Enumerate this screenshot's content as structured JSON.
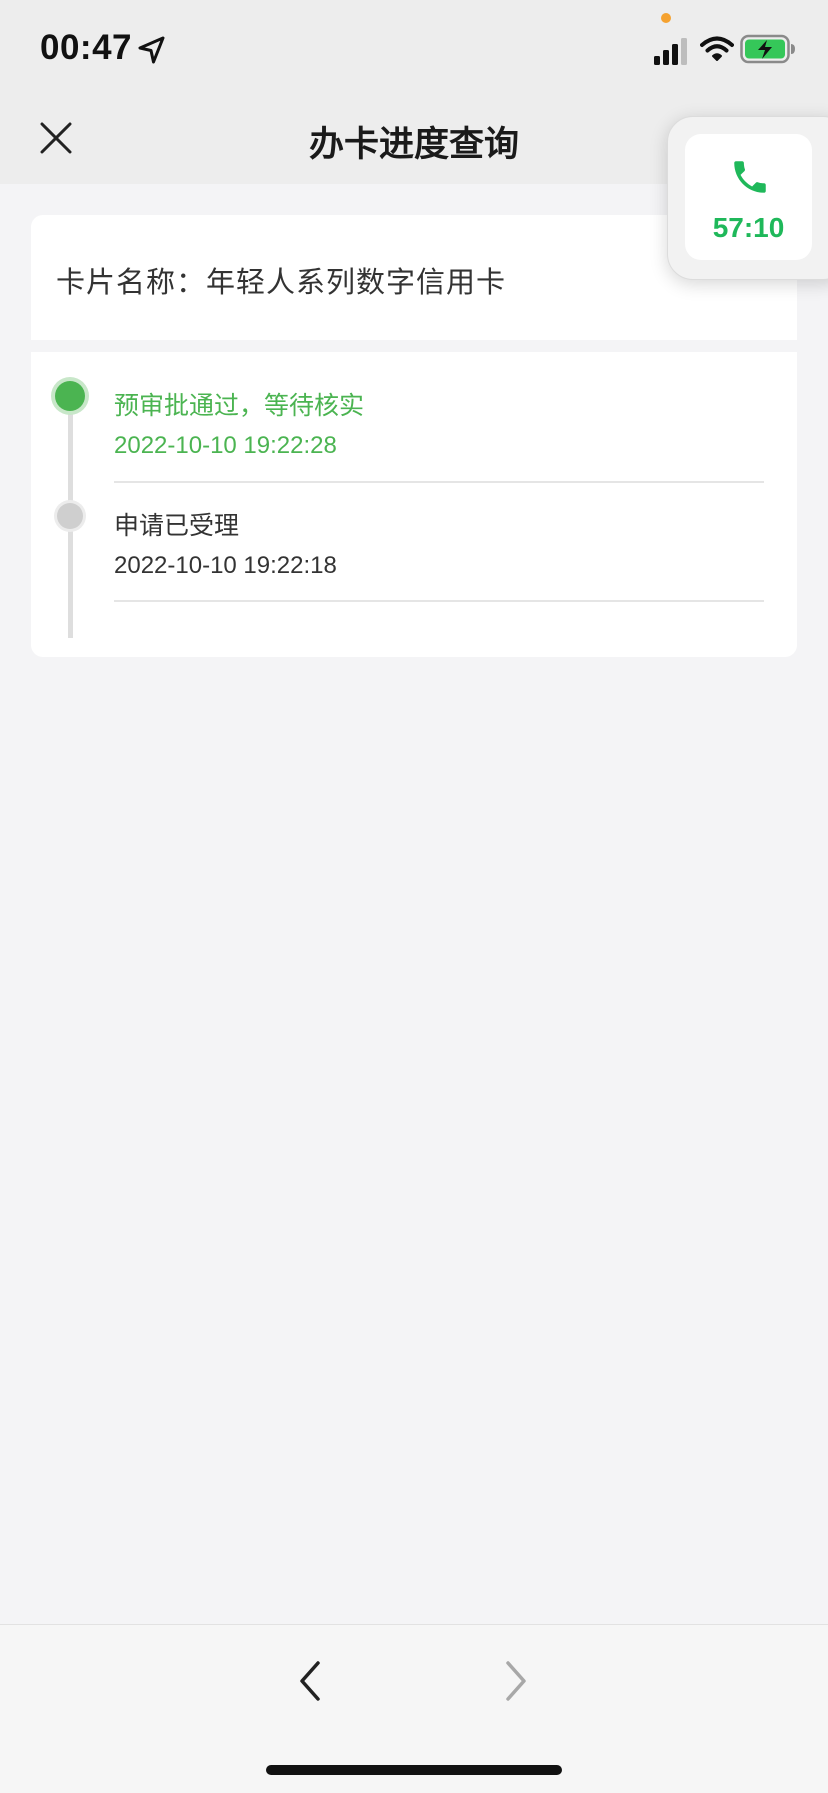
{
  "status_bar": {
    "time": "00:47",
    "location_icon": "location-arrow-icon",
    "signal_icon": "cellular-signal-icon",
    "wifi_icon": "wifi-icon",
    "battery_icon": "battery-charging-icon"
  },
  "nav": {
    "close_icon": "close-icon",
    "title": "办卡进度查询"
  },
  "call_widget": {
    "icon": "phone-icon",
    "timer": "57:10",
    "accent": "#1fb85a"
  },
  "card": {
    "name": "卡片名称：年轻人系列数字信用卡"
  },
  "progress": {
    "steps": [
      {
        "title": "预审批通过，等待核实",
        "time": "2022-10-10 19:22:28",
        "status": "active",
        "color": "#4bb451"
      },
      {
        "title": "申请已受理",
        "time": "2022-10-10 19:22:18",
        "status": "done",
        "color": "#333333"
      }
    ]
  },
  "toolbar": {
    "back_icon": "chevron-left-icon",
    "forward_icon": "chevron-right-icon"
  }
}
